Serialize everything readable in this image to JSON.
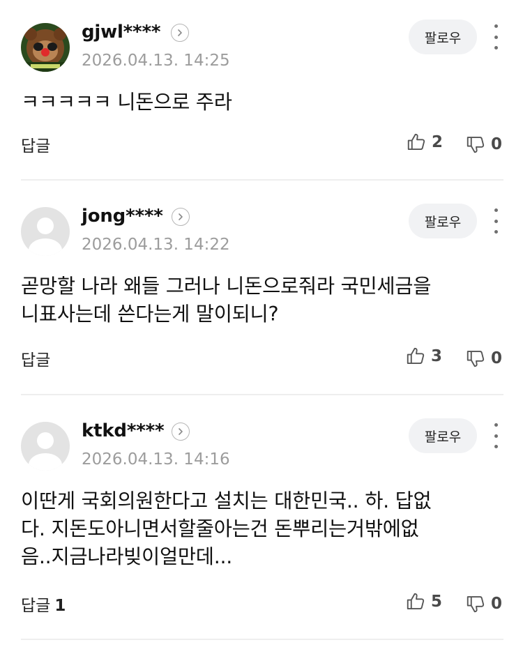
{
  "labels": {
    "follow": "팔로우",
    "reply": "답글"
  },
  "comments": [
    {
      "nickname": "gjwl****",
      "date": "2026.04.13. 14:25",
      "avatar": "cartoon-character",
      "lines": [
        "ㅋㅋㅋㅋㅋ 니돈으로 주라"
      ],
      "reply_count": "",
      "likes": "2",
      "dislikes": "0"
    },
    {
      "nickname": "jong****",
      "date": "2026.04.13. 14:22",
      "avatar": "default",
      "lines": [
        "곧망할 나라 왜들 그러나 니돈으로줘라 국민세금을",
        "니표사는데 쓴다는게 말이되니?"
      ],
      "reply_count": "",
      "likes": "3",
      "dislikes": "0"
    },
    {
      "nickname": "ktkd****",
      "date": "2026.04.13. 14:16",
      "avatar": "default",
      "lines": [
        "이딴게 국회의원한다고 설치는 대한민국.. 하. 답없",
        "다. 지돈도아니면서할줄아는건 돈뿌리는거밖에없",
        "음..지금나라빚이얼만데..."
      ],
      "reply_count": "1",
      "likes": "5",
      "dislikes": "0"
    }
  ],
  "icons": {
    "profile": "chevron-right-icon",
    "more": "kebab-menu-icon",
    "like": "thumbs-up-icon",
    "dislike": "thumbs-down-icon"
  }
}
